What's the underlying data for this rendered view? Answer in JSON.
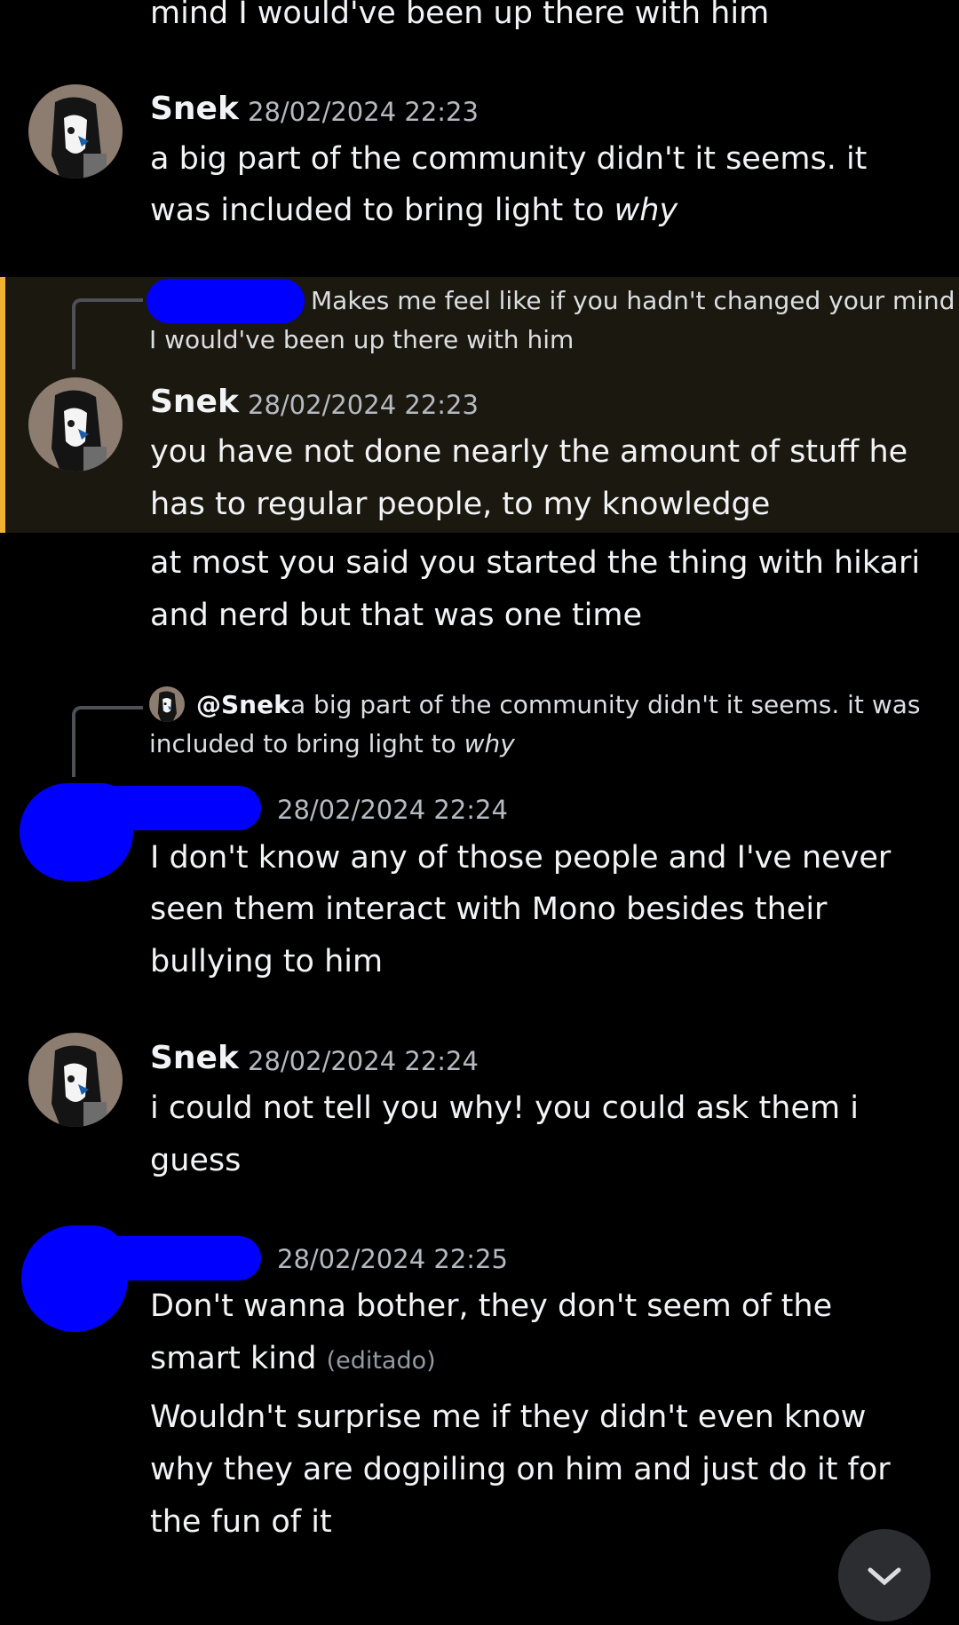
{
  "messages": {
    "m0": {
      "line1": "mind I would've been up there with him"
    },
    "m1": {
      "author": "Snek",
      "time": "28/02/2024 22:23",
      "line1": "a big part of the community didn't it seems. it",
      "line2_pre": "was included to bring light to ",
      "line2_em": "why"
    },
    "m2": {
      "reply_line1": "Makes me feel like if you hadn't changed your mind",
      "reply_line2": "I would've been up there with him",
      "author": "Snek",
      "time": "28/02/2024 22:23",
      "line1": "you have not done nearly the amount of stuff he",
      "line2": "has to regular people, to my knowledge",
      "line3": "at most you said you started the thing with hikari",
      "line4": "and nerd but that was one time"
    },
    "m3": {
      "reply_author": "@Snek",
      "reply_line1": "a big part of the community didn't it seems. it was",
      "reply_line2_pre": "included to bring light to ",
      "reply_line2_em": "why",
      "time": "28/02/2024 22:24",
      "line1": "I don't know any of those people and I've never",
      "line2": "seen them interact with Mono besides their",
      "line3": "bullying to him"
    },
    "m4": {
      "author": "Snek",
      "time": "28/02/2024 22:24",
      "line1": "i could not tell you why! you could ask them i",
      "line2": "guess"
    },
    "m5": {
      "time": "28/02/2024 22:25",
      "line1": "Don't wanna bother, they don't seem of the",
      "line2": "smart kind",
      "edited": "(editado)",
      "line3": "Wouldn't surprise me if they didn't even know",
      "line4": "why they are dogpiling on him and just do it for",
      "line5": "the fun of it"
    }
  },
  "colors": {
    "background": "#000000",
    "text": "#f2f3f5",
    "timestamp": "#b5bac1",
    "highlight_bg": "#1b1810",
    "highlight_bar": "#f0b232",
    "redaction": "#0000ff"
  },
  "icons": {
    "avatar": "snek-avatar",
    "scroll": "scroll-to-bottom-button"
  }
}
